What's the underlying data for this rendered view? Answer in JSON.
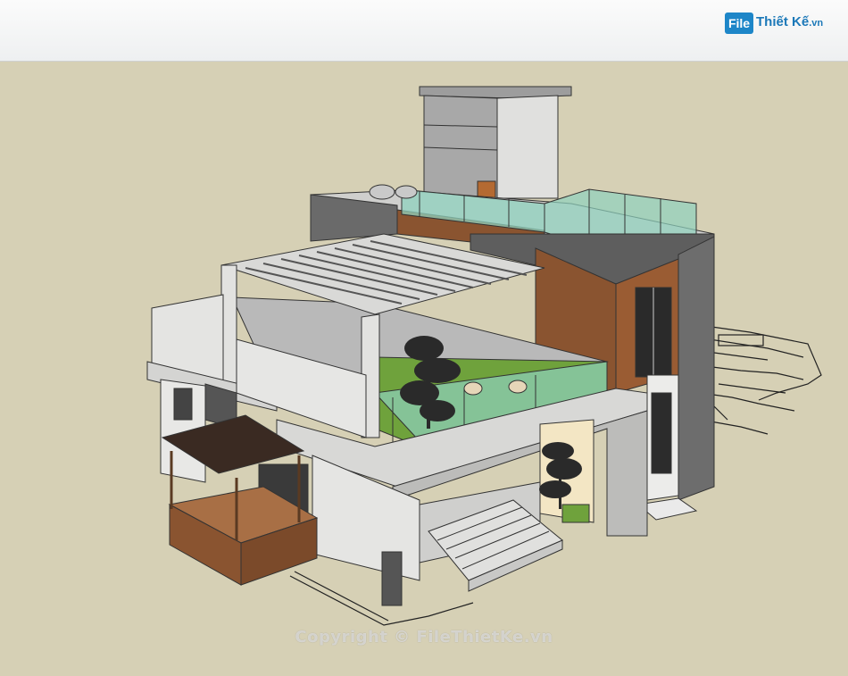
{
  "header": {
    "logo_mark": "File",
    "logo_text": "Thiết Kế",
    "logo_suffix": ".vn"
  },
  "watermark": {
    "text": "Copyright © FileThietKe.vn"
  },
  "colors": {
    "ground": "#d6d0b5",
    "header_bg": "#eef0f1",
    "wall_white": "#e4e4e2",
    "wall_grey": "#6d6d6d",
    "wood": "#8a5430",
    "glass": "#7fc7b4",
    "lawn": "#6fa23c",
    "accent_blue": "#1d86c8"
  },
  "scene": {
    "subject": "3d-house-model",
    "icons": [
      "tree-icon",
      "chair-icon",
      "water-tank-icon"
    ]
  }
}
